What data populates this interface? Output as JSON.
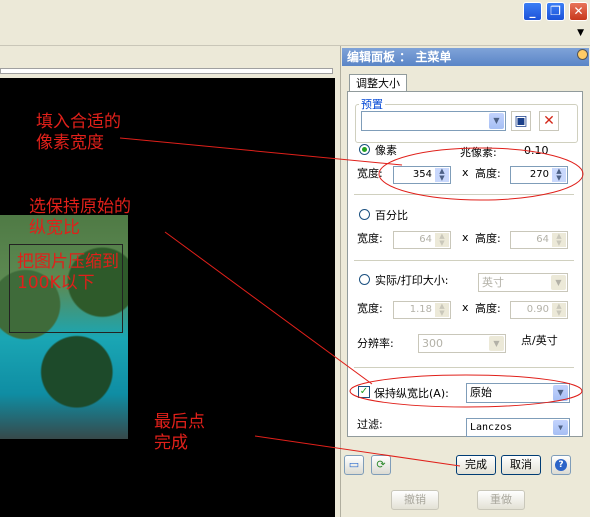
{
  "panel": {
    "title": "编辑面板 ： 主菜单",
    "tab": "调整大小",
    "preset": {
      "label": "预置",
      "value": ""
    },
    "pixels": {
      "label": "像素",
      "megapixels_label": "兆像素:",
      "megapixels_value": "0.10",
      "width_label": "宽度:",
      "width_value": "354",
      "times": "x",
      "height_label": "高度:",
      "height_value": "270"
    },
    "percent": {
      "label": "百分比",
      "width_label": "宽度:",
      "width_value": "64",
      "times": "x",
      "height_label": "高度:",
      "height_value": "64"
    },
    "print": {
      "label": "实际/打印大小:",
      "unit": "英寸",
      "width_label": "宽度:",
      "width_value": "1.18",
      "times": "x",
      "height_label": "高度:",
      "height_value": "0.90",
      "resolution_label": "分辨率:",
      "resolution_value": "300",
      "resolution_unit": "点/英寸"
    },
    "keep_ratio": {
      "label": "保持纵宽比(A):",
      "checked": true,
      "value": "原始"
    },
    "filter": {
      "label": "过滤:",
      "value": "Lanczos"
    },
    "buttons": {
      "done": "完成",
      "cancel": "取消",
      "undo": "撤销",
      "redo": "重做",
      "help": "?"
    }
  },
  "annotations": {
    "fill_width": "填入合适的\n像素宽度",
    "keep_ratio": "选保持原始的\n纵宽比",
    "photo_note": "把图片压缩到100K以下",
    "finish": "最后点\n完成"
  },
  "window": {
    "minimize": "_",
    "restore": "❐",
    "close": "✕"
  },
  "colors": {
    "annotation": "#e0201a",
    "panel_header": "#6b92d0"
  }
}
